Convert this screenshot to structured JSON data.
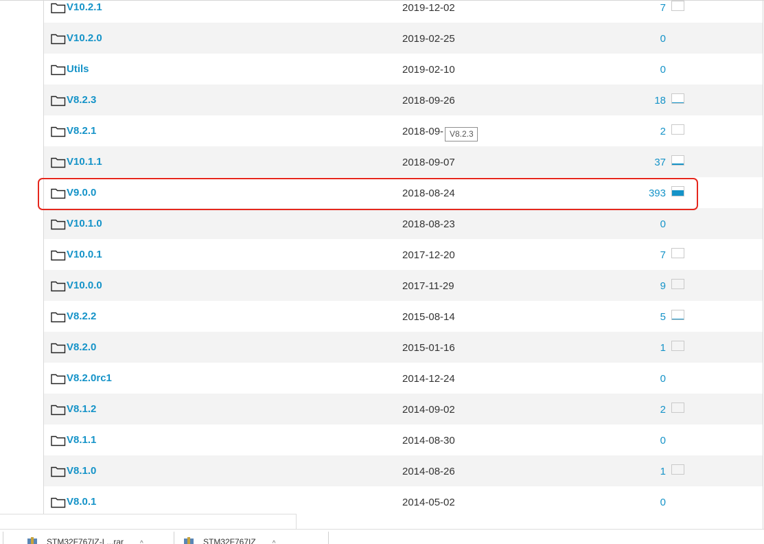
{
  "files": [
    {
      "name": "V10.2.1",
      "date": "2019-12-02",
      "count": "7",
      "spark": "empty",
      "activity": 0
    },
    {
      "name": "V10.2.0",
      "date": "2019-02-25",
      "count": "0",
      "spark": "none",
      "activity": 0
    },
    {
      "name": "Utils",
      "date": "2019-02-10",
      "count": "0",
      "spark": "none",
      "activity": 0
    },
    {
      "name": "V8.2.3",
      "date": "2018-09-26",
      "count": "18",
      "spark": "low",
      "activity": 0.1
    },
    {
      "name": "V8.2.1",
      "date": "2018-09-",
      "count": "2",
      "spark": "empty",
      "activity": 0
    },
    {
      "name": "V10.1.1",
      "date": "2018-09-07",
      "count": "37",
      "spark": "low",
      "activity": 0.12
    },
    {
      "name": "V9.0.0",
      "date": "2018-08-24",
      "count": "393",
      "spark": "high",
      "activity": 0.65
    },
    {
      "name": "V10.1.0",
      "date": "2018-08-23",
      "count": "0",
      "spark": "none",
      "activity": 0
    },
    {
      "name": "V10.0.1",
      "date": "2017-12-20",
      "count": "7",
      "spark": "empty",
      "activity": 0
    },
    {
      "name": "V10.0.0",
      "date": "2017-11-29",
      "count": "9",
      "spark": "empty",
      "activity": 0
    },
    {
      "name": "V8.2.2",
      "date": "2015-08-14",
      "count": "5",
      "spark": "low",
      "activity": 0.05
    },
    {
      "name": "V8.2.0",
      "date": "2015-01-16",
      "count": "1",
      "spark": "empty",
      "activity": 0
    },
    {
      "name": "V8.2.0rc1",
      "date": "2014-12-24",
      "count": "0",
      "spark": "none",
      "activity": 0
    },
    {
      "name": "V8.1.2",
      "date": "2014-09-02",
      "count": "2",
      "spark": "empty",
      "activity": 0
    },
    {
      "name": "V8.1.1",
      "date": "2014-08-30",
      "count": "0",
      "spark": "none",
      "activity": 0
    },
    {
      "name": "V8.1.0",
      "date": "2014-08-26",
      "count": "1",
      "spark": "empty",
      "activity": 0
    },
    {
      "name": "V8.0.1",
      "date": "2014-05-02",
      "count": "0",
      "spark": "none",
      "activity": 0
    }
  ],
  "tooltip": "V8.2.3",
  "downloads": [
    {
      "name": "STM32F767IZ-L...rar"
    },
    {
      "name": "STM32F767IZ"
    }
  ],
  "colors": {
    "link": "#1593c8",
    "highlight": "#e5271d",
    "alt_row": "#f3f3f3"
  }
}
